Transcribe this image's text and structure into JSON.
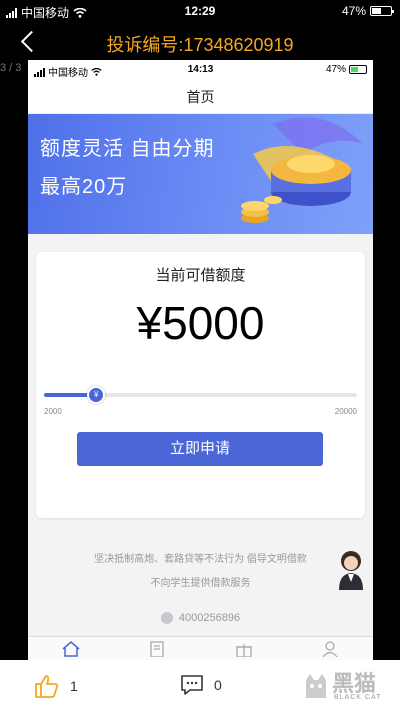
{
  "outer_status": {
    "carrier": "中国移动",
    "time": "12:29",
    "battery": "47%"
  },
  "outer_nav": {
    "title": "投诉编号:17348620919",
    "page_counter": "3 / 3"
  },
  "inner_status": {
    "carrier": "中国移动",
    "time": "14:13",
    "battery": "47%"
  },
  "inner_header": {
    "title": "首页"
  },
  "banner": {
    "line1": "额度灵活 自由分期",
    "line2": "最高20万"
  },
  "loan_card": {
    "label": "当前可借额度",
    "amount": "¥5000",
    "slider_min": "2000",
    "slider_max": "20000",
    "slider_value": 5000,
    "slider_thumb": "¥",
    "apply_button": "立即申请"
  },
  "notices": {
    "line1": "坚决抵制高炮、套路贷等不法行为 倡导文明借款",
    "line2": "不向学生提供借款服务",
    "phone": "4000256896"
  },
  "tabbar": {
    "icons": [
      "home-icon",
      "document-icon",
      "gift-icon",
      "user-icon"
    ]
  },
  "bottom_bar": {
    "like_count": "1",
    "comment_count": "0"
  },
  "watermark": {
    "text": "黑猫",
    "sub": "BLACK CAT"
  },
  "colors": {
    "accent": "#4a66d6",
    "title_orange": "#f5a623",
    "banner_start": "#4f6fe8"
  }
}
